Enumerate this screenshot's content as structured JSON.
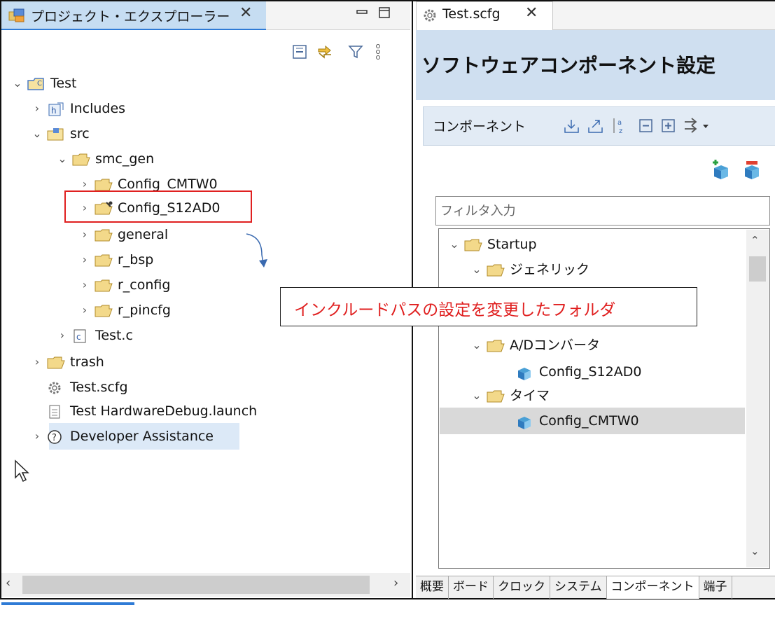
{
  "left_panel": {
    "tab_title": "プロジェクト・エクスプローラー",
    "close_glyph": "✕",
    "minimize_glyph": "▭",
    "maximize_glyph": "☐",
    "toolbar_icons": [
      "collapse-all-icon",
      "link-with-editor-icon",
      "filter-icon",
      "view-menu-icon"
    ],
    "tree": [
      {
        "label": "Test",
        "chevron": "⌄",
        "icon": "project-icon"
      },
      {
        "label": "Includes",
        "chevron": "›",
        "icon": "includes-icon"
      },
      {
        "label": "src",
        "chevron": "⌄",
        "icon": "source-folder-icon"
      },
      {
        "label": "smc_gen",
        "chevron": "⌄",
        "icon": "folder-icon"
      },
      {
        "label": "Config_CMTW0",
        "chevron": "›",
        "icon": "folder-icon"
      },
      {
        "label": "Config_S12AD0",
        "chevron": "›",
        "icon": "configured-folder-icon"
      },
      {
        "label": "general",
        "chevron": "›",
        "icon": "folder-icon"
      },
      {
        "label": "r_bsp",
        "chevron": "›",
        "icon": "folder-icon"
      },
      {
        "label": "r_config",
        "chevron": "›",
        "icon": "folder-icon"
      },
      {
        "label": "r_pincfg",
        "chevron": "›",
        "icon": "folder-icon"
      },
      {
        "label": "Test.c",
        "chevron": "›",
        "icon": "c-file-icon"
      },
      {
        "label": "trash",
        "chevron": "›",
        "icon": "folder-icon"
      },
      {
        "label": "Test.scfg",
        "chevron": "",
        "icon": "gear-icon"
      },
      {
        "label": "Test HardwareDebug.launch",
        "chevron": "",
        "icon": "document-icon"
      },
      {
        "label": "Developer Assistance",
        "chevron": "›",
        "icon": "help-icon"
      }
    ]
  },
  "right_panel": {
    "tab_title": "Test.scfg",
    "close_glyph": "✕",
    "title": "ソフトウェアコンポーネント設定",
    "components_label": "コンポーネント",
    "filter_placeholder": "フィルタ入力",
    "tree": [
      {
        "label": "Startup",
        "chevron": "⌄",
        "icon": "folder-icon"
      },
      {
        "label": "ジェネリック",
        "chevron": "⌄",
        "icon": "folder-icon"
      },
      {
        "label": "A/Dコンバータ",
        "chevron": "⌄",
        "icon": "folder-icon"
      },
      {
        "label": "Config_S12AD0",
        "chevron": "",
        "icon": "component-icon"
      },
      {
        "label": "タイマ",
        "chevron": "⌄",
        "icon": "folder-icon"
      },
      {
        "label": "Config_CMTW0",
        "chevron": "",
        "icon": "component-icon",
        "selected": true
      }
    ],
    "bottom_tabs": [
      "概要",
      "ボード",
      "クロック",
      "システム",
      "コンポーネント",
      "端子"
    ],
    "active_bottom_tab": "コンポーネント"
  },
  "callout": {
    "text": "インクルードパスの設定を変更したフォルダ"
  },
  "colors": {
    "accent": "#2f7bd6",
    "highlight_red": "#e02020",
    "header_bg": "#cfdff0",
    "folder": "#e8c56a"
  }
}
